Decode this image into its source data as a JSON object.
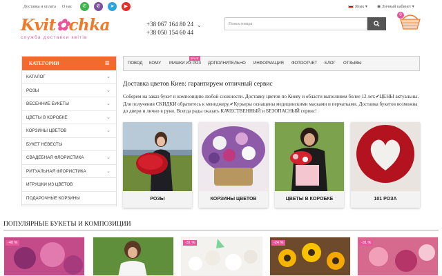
{
  "topbar": {
    "links": [
      "Доставка и оплата",
      "О нас"
    ],
    "language": "Язык",
    "account": "Личный кабинет",
    "social": [
      "whatsapp-icon",
      "viber-icon",
      "telegram-icon",
      "youtube-icon"
    ]
  },
  "logo": {
    "text_start": "Kvit",
    "text_end": "chka",
    "tagline": "служба доставки квітів"
  },
  "phones": [
    "+38 067 164 80 24",
    "+38 050 154 60 44"
  ],
  "search": {
    "placeholder": "Поиск товара"
  },
  "cart": {
    "count": "0"
  },
  "sidebar": {
    "title": "КАТЕГОРИИ",
    "items": [
      {
        "label": "КАТАЛОГ",
        "expandable": true
      },
      {
        "label": "РОЗЫ",
        "expandable": true
      },
      {
        "label": "ВЕСЕННИЕ БУКЕТЫ",
        "expandable": true
      },
      {
        "label": "ЦВЕТЫ В КОРОБКЕ",
        "expandable": true
      },
      {
        "label": "КОРЗИНЫ ЦВЕТОВ",
        "expandable": true
      },
      {
        "label": "БУКЕТ НЕВЕСТЫ",
        "expandable": false
      },
      {
        "label": "СВАДЕБНАЯ ФЛОРИСТИКА",
        "expandable": true
      },
      {
        "label": "РИТУАЛЬНАЯ ФЛОРИСТИКА",
        "expandable": true
      },
      {
        "label": "ИГРУШКИ ИЗ ЦВЕТОВ",
        "expandable": false
      },
      {
        "label": "ПОДАРОЧНЫЕ КОРЗИНЫ",
        "expandable": false
      }
    ]
  },
  "nav": {
    "items": [
      "ПОВОД",
      "КОМУ",
      "МИШКИ ИЗ РОЗ",
      "ДОПОЛНИТЕЛЬНО",
      "ИНФОРМАЦИЯ",
      "ФОТООТЧЕТ",
      "БЛОГ",
      "ОТЗЫВЫ"
    ],
    "sale_badge": "SALE"
  },
  "main": {
    "title": "Доставка цветов Киев: гарантируем отличный сервис",
    "text": "Соберем на заказ букет и композицию любой сложности. Доставку цветов по Киеву и области выполняем более 12 лет.✔ЦЕНЫ актуальны. Для получения СКИДКИ обратитесь к менеджеру.✔Курьеры оснащены медицинскими масками и перчатками. Доставка букетов возможна до двери и лично в руки. Всегда рады оказать КАЧЕСТВЕННЫЙ и БЕЗОПАСНЫЙ сервис!"
  },
  "categories": [
    {
      "label": "РОЗЫ"
    },
    {
      "label": "КОРЗИНЫ ЦВЕТОВ"
    },
    {
      "label": "ЦВЕТЫ В КОРОБКЕ"
    },
    {
      "label": "101 РОЗА"
    }
  ],
  "popular": {
    "title": "ПОПУЛЯРНЫЕ БУКЕТЫ И КОМПОЗИЦИИ",
    "discounts": [
      "-40 %",
      "",
      "-31 %",
      "-24 %",
      "-31 %"
    ]
  },
  "colors": {
    "accent": "#f26a2e",
    "pink": "#e8569a"
  }
}
